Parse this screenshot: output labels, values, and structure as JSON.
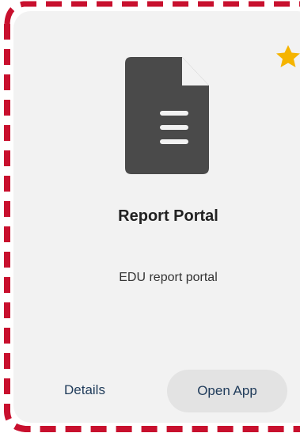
{
  "card": {
    "title": "Report Portal",
    "description": "EDU report portal",
    "details_label": "Details",
    "open_label": "Open App",
    "favorite": true
  },
  "icons": {
    "app": "document-icon",
    "favorite": "star-icon"
  },
  "colors": {
    "card_background": "#f2f2f2",
    "doc_icon": "#4a4a4a",
    "star": "#f5b400",
    "dashed_border": "#c8102e",
    "link_text": "#1f3b5a",
    "button_background": "#e3e3e3"
  }
}
